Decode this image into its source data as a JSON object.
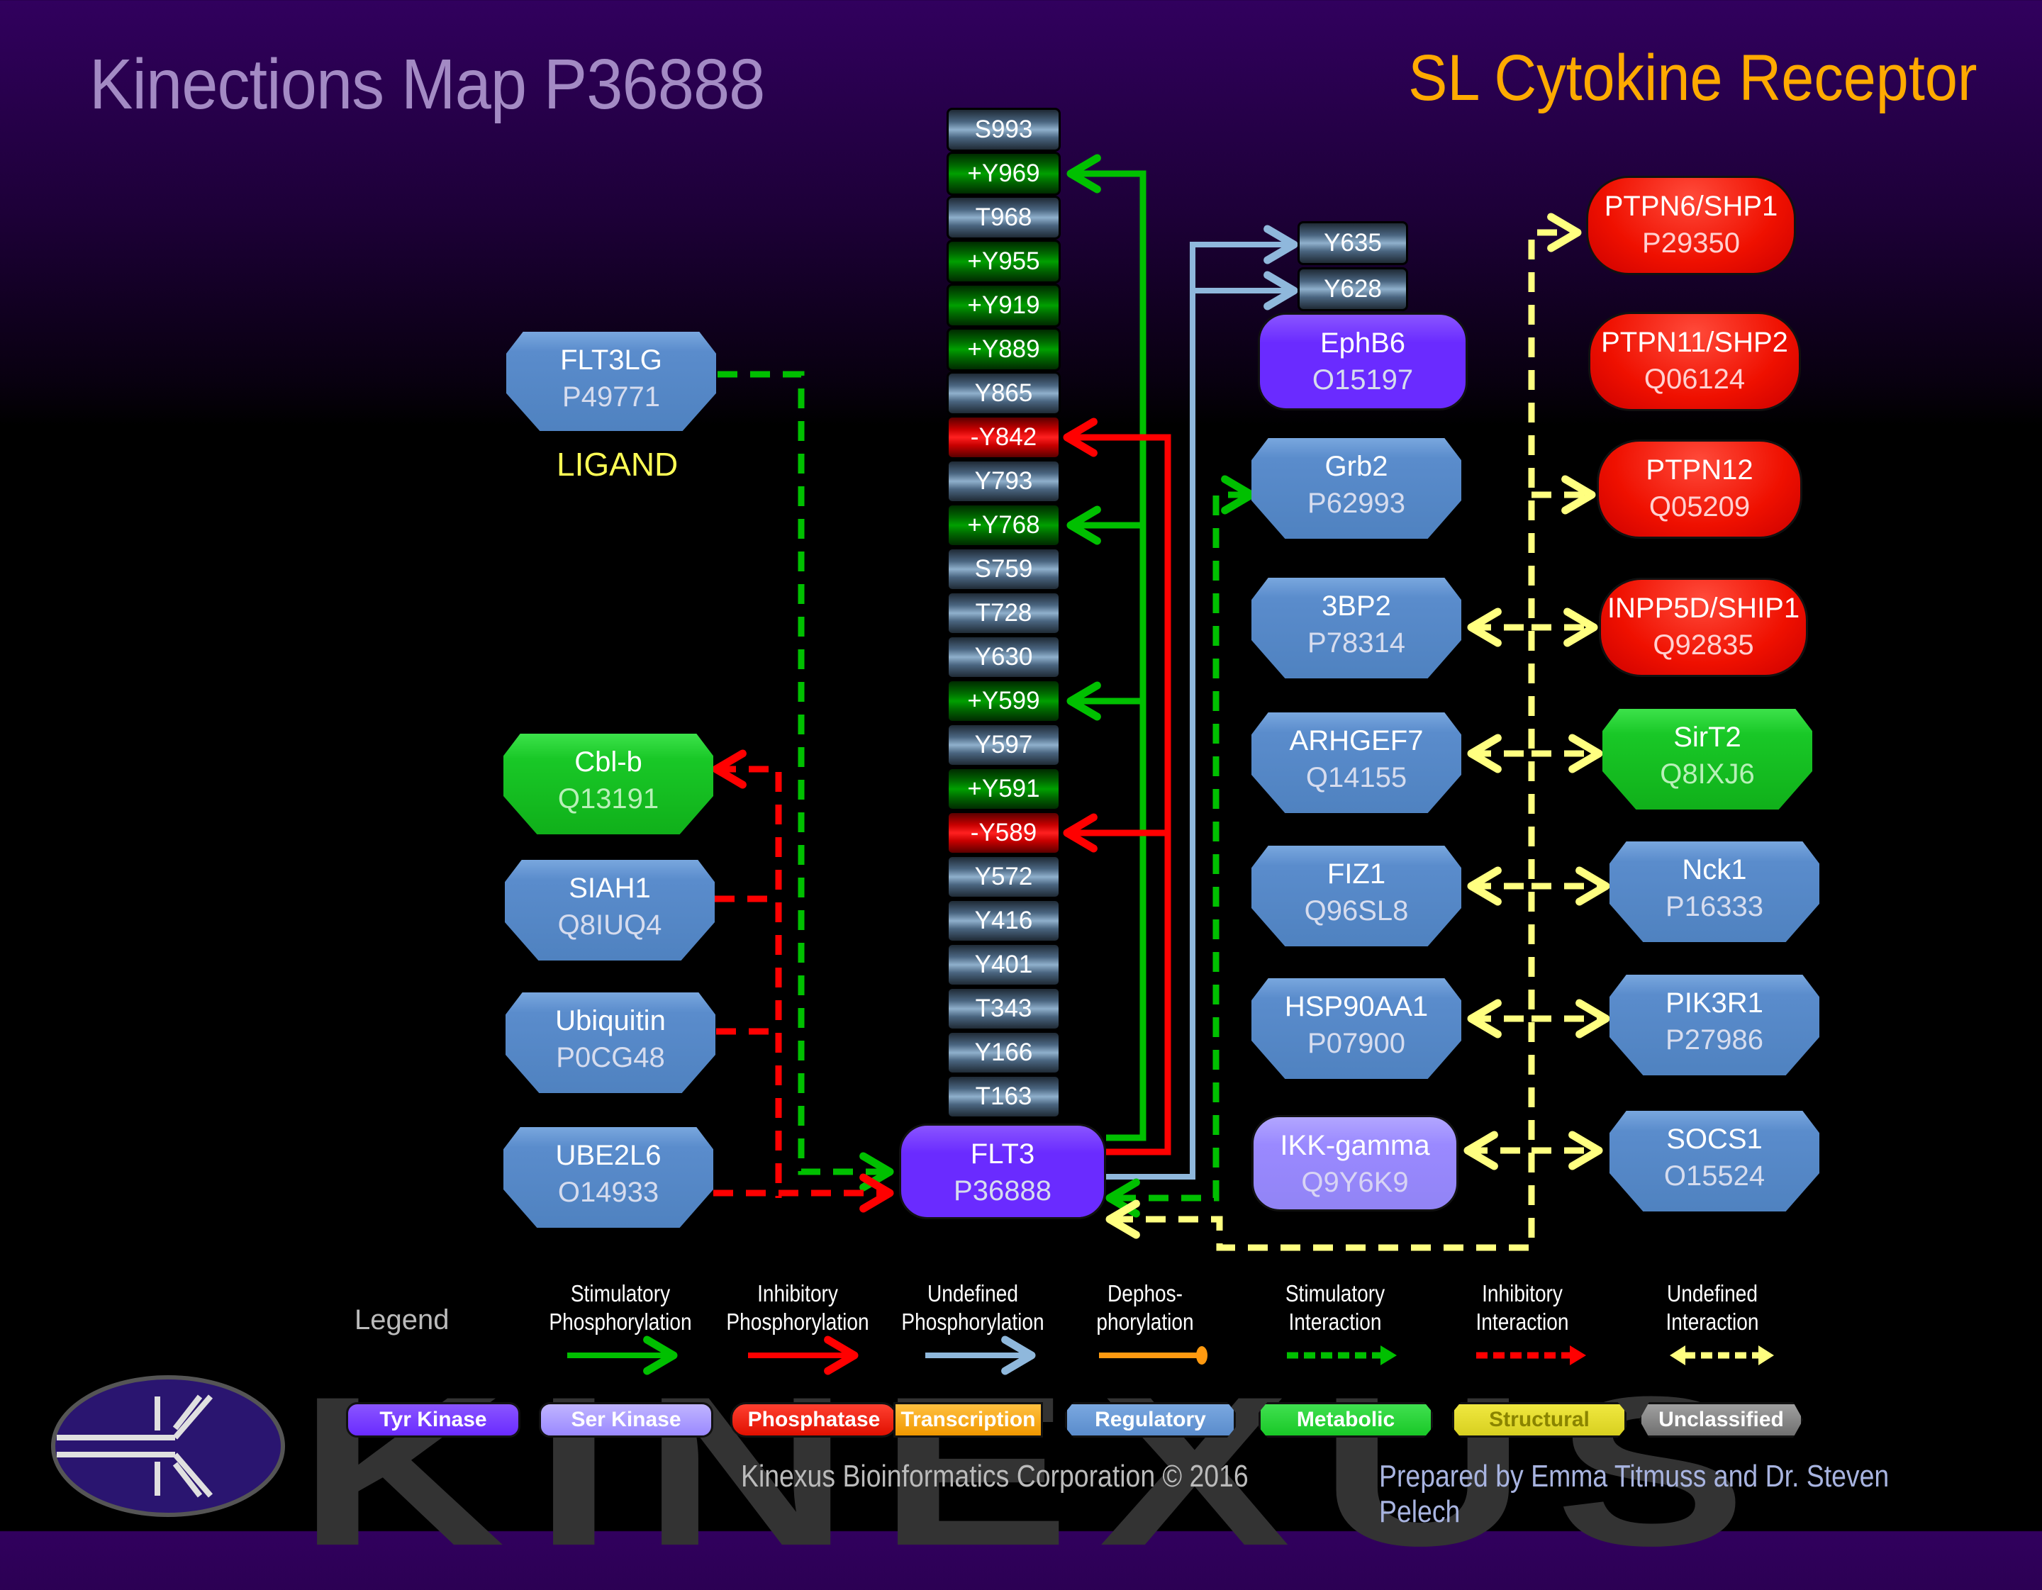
{
  "header": {
    "title": "Kinections Map P36888",
    "subtitle": "SL Cytokine Receptor"
  },
  "watermark": "KINEXUS",
  "central_protein": {
    "name": "FLT3",
    "accession": "P36888",
    "category": "Tyr Kinase"
  },
  "phosphosites": [
    {
      "label": "S993",
      "effect": "neutral"
    },
    {
      "label": "+Y969",
      "effect": "stim"
    },
    {
      "label": "T968",
      "effect": "neutral"
    },
    {
      "label": "+Y955",
      "effect": "stim"
    },
    {
      "label": "+Y919",
      "effect": "stim"
    },
    {
      "label": "+Y889",
      "effect": "stim"
    },
    {
      "label": "Y865",
      "effect": "neutral"
    },
    {
      "label": "-Y842",
      "effect": "inhib"
    },
    {
      "label": "Y793",
      "effect": "neutral"
    },
    {
      "label": "+Y768",
      "effect": "stim"
    },
    {
      "label": "S759",
      "effect": "neutral"
    },
    {
      "label": "T728",
      "effect": "neutral"
    },
    {
      "label": "Y630",
      "effect": "neutral"
    },
    {
      "label": "+Y599",
      "effect": "stim"
    },
    {
      "label": "Y597",
      "effect": "neutral"
    },
    {
      "label": "+Y591",
      "effect": "stim"
    },
    {
      "label": "-Y589",
      "effect": "inhib"
    },
    {
      "label": "Y572",
      "effect": "neutral"
    },
    {
      "label": "Y416",
      "effect": "neutral"
    },
    {
      "label": "Y401",
      "effect": "neutral"
    },
    {
      "label": "T343",
      "effect": "neutral"
    },
    {
      "label": "Y166",
      "effect": "neutral"
    },
    {
      "label": "T163",
      "effect": "neutral"
    }
  ],
  "ligand": {
    "name": "FLT3LG",
    "accession": "P49771",
    "label": "LIGAND"
  },
  "upstream": [
    {
      "name": "Cbl-b",
      "accession": "Q13191",
      "category": "Metabolic"
    },
    {
      "name": "SIAH1",
      "accession": "Q8IUQ4",
      "category": "Regulatory"
    },
    {
      "name": "Ubiquitin",
      "accession": "P0CG48",
      "category": "Regulatory"
    },
    {
      "name": "UBE2L6",
      "accession": "O14933",
      "category": "Regulatory"
    }
  ],
  "substrate": {
    "name": "EphB6",
    "accession": "O15197",
    "category": "Tyr Kinase",
    "sites": [
      "Y635",
      "Y628"
    ]
  },
  "interactors_left": [
    {
      "name": "Grb2",
      "accession": "P62993",
      "category": "Regulatory"
    },
    {
      "name": "3BP2",
      "accession": "P78314",
      "category": "Regulatory"
    },
    {
      "name": "ARHGEF7",
      "accession": "Q14155",
      "category": "Regulatory"
    },
    {
      "name": "FIZ1",
      "accession": "Q96SL8",
      "category": "Regulatory"
    },
    {
      "name": "HSP90AA1",
      "accession": "P07900",
      "category": "Regulatory"
    },
    {
      "name": "IKK-gamma",
      "accession": "Q9Y6K9",
      "category": "Ser Kinase"
    }
  ],
  "interactors_right": [
    {
      "name": "PTPN6/SHP1",
      "accession": "P29350",
      "category": "Phosphatase"
    },
    {
      "name": "PTPN11/SHP2",
      "accession": "Q06124",
      "category": "Phosphatase"
    },
    {
      "name": "PTPN12",
      "accession": "Q05209",
      "category": "Phosphatase"
    },
    {
      "name": "INPP5D/SHIP1",
      "accession": "Q92835",
      "category": "Phosphatase"
    },
    {
      "name": "SirT2",
      "accession": "Q8IXJ6",
      "category": "Metabolic"
    },
    {
      "name": "Nck1",
      "accession": "P16333",
      "category": "Regulatory"
    },
    {
      "name": "PIK3R1",
      "accession": "P27986",
      "category": "Regulatory"
    },
    {
      "name": "SOCS1",
      "accession": "O15524",
      "category": "Regulatory"
    }
  ],
  "legend": {
    "title": "Legend",
    "arrows": [
      {
        "line1": "Stimulatory",
        "line2": "Phosphorylation",
        "color": "#00c000",
        "style": "solid"
      },
      {
        "line1": "Inhibitory",
        "line2": "Phosphorylation",
        "color": "#ff0000",
        "style": "solid"
      },
      {
        "line1": "Undefined",
        "line2": "Phosphorylation",
        "color": "#8fb8dc",
        "style": "solid"
      },
      {
        "line1": "Dephos-",
        "line2": "phorylation",
        "color": "#ff9a10",
        "style": "ball"
      },
      {
        "line1": "Stimulatory",
        "line2": "Interaction",
        "color": "#00c000",
        "style": "dashed"
      },
      {
        "line1": "Inhibitory",
        "line2": "Interaction",
        "color": "#ff0000",
        "style": "dashed"
      },
      {
        "line1": "Undefined",
        "line2": "Interaction",
        "color": "#ffff80",
        "style": "dashed-both"
      }
    ],
    "categories": [
      {
        "label": "Tyr Kinase",
        "color": "#6a2bff"
      },
      {
        "label": "Ser Kinase",
        "color": "#9a89ff"
      },
      {
        "label": "Phosphatase",
        "color": "#ee1100"
      },
      {
        "label": "Transcription",
        "color": "#ffa820"
      },
      {
        "label": "Regulatory",
        "color": "#5a8ccc"
      },
      {
        "label": "Metabolic",
        "color": "#19c827"
      },
      {
        "label": "Structural",
        "color": "#e0d820"
      },
      {
        "label": "Unclassified",
        "color": "#808080"
      }
    ]
  },
  "footer": {
    "copyright": "Kinexus Bioinformatics Corporation © 2016",
    "credits": "Prepared by Emma Titmuss and Dr. Steven Pelech"
  }
}
